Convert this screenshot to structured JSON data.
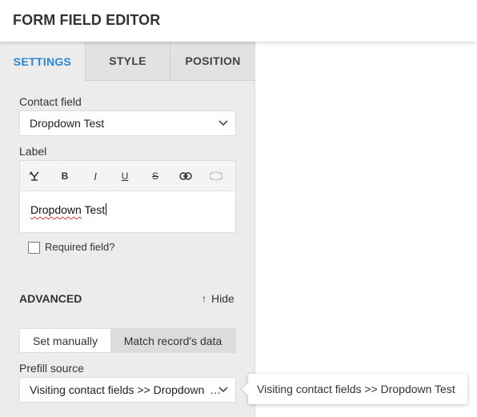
{
  "header": {
    "title": "FORM FIELD EDITOR"
  },
  "tabs": [
    {
      "label": "SETTINGS",
      "active": true
    },
    {
      "label": "STYLE",
      "active": false
    },
    {
      "label": "POSITION",
      "active": false
    }
  ],
  "contact_field": {
    "label": "Contact field",
    "value": "Dropdown Test"
  },
  "label_editor": {
    "label": "Label",
    "toolbar": [
      "variable-icon",
      "bold-icon",
      "italic-icon",
      "underline-icon",
      "strikethrough-icon",
      "link-icon",
      "unlink-icon"
    ],
    "toolbar_text": {
      "bold": "B",
      "italic": "I",
      "underline": "U",
      "strike": "S"
    },
    "text_word1": "Dropdown",
    "text_word2": " Test"
  },
  "required": {
    "label": "Required field?",
    "checked": false
  },
  "advanced": {
    "title": "ADVANCED",
    "hide_arrow": "↑",
    "hide_label": "Hide"
  },
  "prefill_mode": {
    "options": [
      "Set manually",
      "Match record's data"
    ],
    "selected": "Match record's data"
  },
  "prefill_source": {
    "label": "Prefill source",
    "value": "Visiting contact fields >> Dropdown Test",
    "display": "Visiting contact fields >> Dropdown"
  },
  "tooltip": {
    "text": "Visiting contact fields >> Dropdown Test"
  },
  "colors": {
    "accent": "#2a86d8",
    "panel": "#ececec",
    "tab_inactive": "#e2e2e2",
    "segment_selected": "#dcdcdc"
  }
}
